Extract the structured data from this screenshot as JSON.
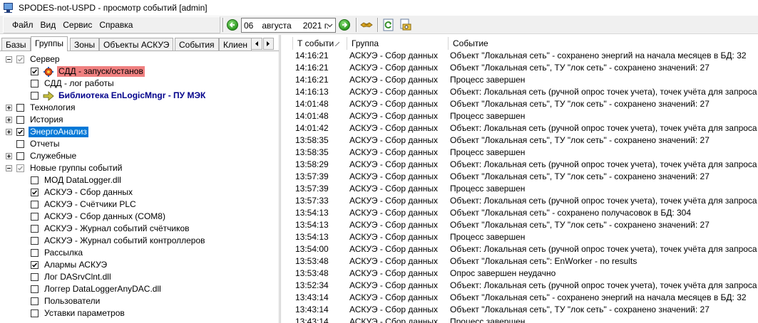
{
  "window": {
    "title": "SPODES-not-USPD - просмотр событий [admin]"
  },
  "menu": [
    "Файл",
    "Вид",
    "Сервис",
    "Справка"
  ],
  "date": {
    "day": "06",
    "month": "августа",
    "year": "2021 г."
  },
  "tabs": [
    "Базы",
    "Группы",
    "Зоны",
    "Объекты АСКУЭ",
    "События",
    "Клиен"
  ],
  "active_tab": 1,
  "tree": [
    {
      "label": "Сервер",
      "level": 0,
      "expander": "minus",
      "checked": true,
      "gray": true,
      "icon": "",
      "style": ""
    },
    {
      "label": "СДД - запуск/останов",
      "level": 1,
      "expander": "",
      "checked": true,
      "gray": false,
      "icon": "service-gear-icon",
      "style": "red"
    },
    {
      "label": "СДД - лог работы",
      "level": 1,
      "expander": "",
      "checked": false,
      "gray": false,
      "icon": "",
      "style": ""
    },
    {
      "label": "Библиотека EnLogicMngr - ПУ МЭК",
      "level": 1,
      "expander": "",
      "checked": false,
      "gray": false,
      "icon": "library-arrow-icon",
      "style": "boldblue"
    },
    {
      "label": "Технология",
      "level": 0,
      "expander": "plus",
      "checked": false,
      "gray": false,
      "icon": "",
      "style": ""
    },
    {
      "label": "История",
      "level": 0,
      "expander": "plus",
      "checked": false,
      "gray": false,
      "icon": "",
      "style": ""
    },
    {
      "label": "ЭнергоАнализ",
      "level": 0,
      "expander": "plus",
      "checked": true,
      "gray": false,
      "icon": "",
      "style": "blue"
    },
    {
      "label": "Отчеты",
      "level": 0,
      "expander": "",
      "checked": false,
      "gray": false,
      "icon": "",
      "style": ""
    },
    {
      "label": "Служебные",
      "level": 0,
      "expander": "plus",
      "checked": false,
      "gray": false,
      "icon": "",
      "style": ""
    },
    {
      "label": "Новые группы событий",
      "level": 0,
      "expander": "minus",
      "checked": true,
      "gray": true,
      "icon": "",
      "style": ""
    },
    {
      "label": "МОД DataLogger.dll",
      "level": 1,
      "expander": "",
      "checked": false,
      "gray": false,
      "icon": "",
      "style": ""
    },
    {
      "label": "АСКУЭ - Сбор данных",
      "level": 1,
      "expander": "",
      "checked": true,
      "gray": false,
      "icon": "",
      "style": ""
    },
    {
      "label": "АСКУЭ - Счётчики PLC",
      "level": 1,
      "expander": "",
      "checked": false,
      "gray": false,
      "icon": "",
      "style": ""
    },
    {
      "label": "АСКУЭ - Сбор данных (COM8)",
      "level": 1,
      "expander": "",
      "checked": false,
      "gray": false,
      "icon": "",
      "style": ""
    },
    {
      "label": "АСКУЭ - Журнал событий счётчиков",
      "level": 1,
      "expander": "",
      "checked": false,
      "gray": false,
      "icon": "",
      "style": ""
    },
    {
      "label": "АСКУЭ - Журнал событий контроллеров",
      "level": 1,
      "expander": "",
      "checked": false,
      "gray": false,
      "icon": "",
      "style": ""
    },
    {
      "label": "Рассылка",
      "level": 1,
      "expander": "",
      "checked": false,
      "gray": false,
      "icon": "",
      "style": ""
    },
    {
      "label": "Алармы АСКУЭ",
      "level": 1,
      "expander": "",
      "checked": true,
      "gray": false,
      "icon": "",
      "style": ""
    },
    {
      "label": "Лог DASrvClnt.dll",
      "level": 1,
      "expander": "",
      "checked": false,
      "gray": false,
      "icon": "",
      "style": ""
    },
    {
      "label": "Логгер DataLoggerAnyDAC.dll",
      "level": 1,
      "expander": "",
      "checked": false,
      "gray": false,
      "icon": "",
      "style": ""
    },
    {
      "label": "Пользователи",
      "level": 1,
      "expander": "",
      "checked": false,
      "gray": false,
      "icon": "",
      "style": ""
    },
    {
      "label": "Уставки параметров",
      "level": 1,
      "expander": "",
      "checked": false,
      "gray": false,
      "icon": "",
      "style": ""
    }
  ],
  "grid": {
    "columns": [
      "Т событи",
      "Группа",
      "Событие"
    ],
    "rows": [
      [
        "14:16:21",
        "АСКУЭ - Сбор данных",
        "Объект \"Локальная сеть\" - сохранено энергий на начала месяцев в БД: 32"
      ],
      [
        "14:16:21",
        "АСКУЭ - Сбор данных",
        "Объект \"Локальная сеть\", ТУ \"лок сеть\" - сохранено значений: 27"
      ],
      [
        "14:16:21",
        "АСКУЭ - Сбор данных",
        "Процесс завершен"
      ],
      [
        "14:16:13",
        "АСКУЭ - Сбор данных",
        "Объект: Локальная сеть (ручной опрос точек учета), точек учёта для запроса"
      ],
      [
        "14:01:48",
        "АСКУЭ - Сбор данных",
        "Объект \"Локальная сеть\", ТУ \"лок сеть\" - сохранено значений: 27"
      ],
      [
        "14:01:48",
        "АСКУЭ - Сбор данных",
        "Процесс завершен"
      ],
      [
        "14:01:42",
        "АСКУЭ - Сбор данных",
        "Объект: Локальная сеть (ручной опрос точек учета), точек учёта для запроса"
      ],
      [
        "13:58:35",
        "АСКУЭ - Сбор данных",
        "Объект \"Локальная сеть\", ТУ \"лок сеть\" - сохранено значений: 27"
      ],
      [
        "13:58:35",
        "АСКУЭ - Сбор данных",
        "Процесс завершен"
      ],
      [
        "13:58:29",
        "АСКУЭ - Сбор данных",
        "Объект: Локальная сеть (ручной опрос точек учета), точек учёта для запроса"
      ],
      [
        "13:57:39",
        "АСКУЭ - Сбор данных",
        "Объект \"Локальная сеть\", ТУ \"лок сеть\" - сохранено значений: 27"
      ],
      [
        "13:57:39",
        "АСКУЭ - Сбор данных",
        "Процесс завершен"
      ],
      [
        "13:57:33",
        "АСКУЭ - Сбор данных",
        "Объект: Локальная сеть (ручной опрос точек учета), точек учёта для запроса"
      ],
      [
        "13:54:13",
        "АСКУЭ - Сбор данных",
        "Объект \"Локальная сеть\" - сохранено получасовок в БД: 304"
      ],
      [
        "13:54:13",
        "АСКУЭ - Сбор данных",
        "Объект \"Локальная сеть\", ТУ \"лок сеть\" - сохранено значений: 27"
      ],
      [
        "13:54:13",
        "АСКУЭ - Сбор данных",
        "Процесс завершен"
      ],
      [
        "13:54:00",
        "АСКУЭ - Сбор данных",
        "Объект: Локальная сеть (ручной опрос точек учета), точек учёта для запроса"
      ],
      [
        "13:53:48",
        "АСКУЭ - Сбор данных",
        "Объект \"Локальная сеть\": EnWorker - no results"
      ],
      [
        "13:53:48",
        "АСКУЭ - Сбор данных",
        "Опрос завершен неудачно"
      ],
      [
        "13:52:34",
        "АСКУЭ - Сбор данных",
        "Объект: Локальная сеть (ручной опрос точек учета), точек учёта для запроса"
      ],
      [
        "13:43:14",
        "АСКУЭ - Сбор данных",
        "Объект \"Локальная сеть\" - сохранено энергий на начала месяцев в БД: 32"
      ],
      [
        "13:43:14",
        "АСКУЭ - Сбор данных",
        "Объект \"Локальная сеть\", ТУ \"лок сеть\" - сохранено значений: 27"
      ],
      [
        "13:43:14",
        "АСКУЭ - Сбор данных",
        "Процесс завершен"
      ]
    ]
  }
}
